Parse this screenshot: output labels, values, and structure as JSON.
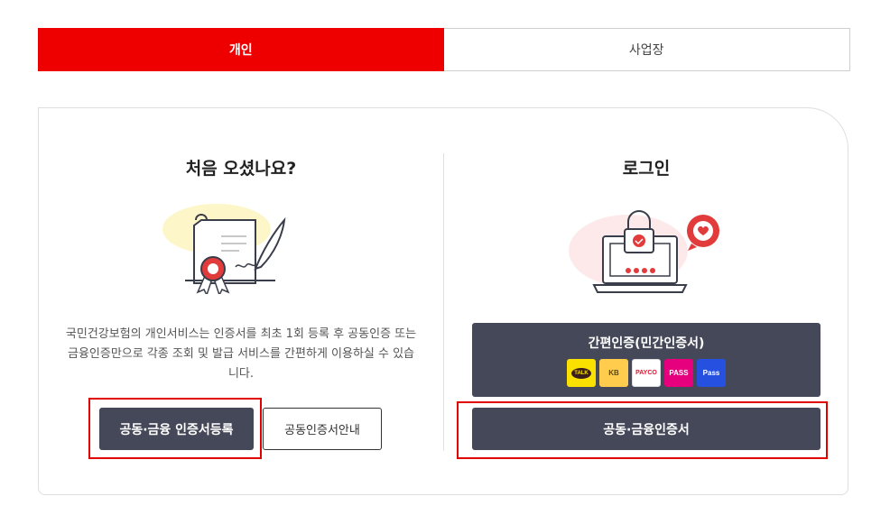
{
  "tabs": [
    {
      "label": "개인",
      "active": true
    },
    {
      "label": "사업장",
      "active": false
    }
  ],
  "left": {
    "title": "처음 오셨나요?",
    "description": "국민건강보험의 개인서비스는 인증서를 최초 1회 등록 후 공동인증 또는 금융인증만으로 각종 조회 및 발급 서비스를 간편하게 이용하실 수 있습니다.",
    "register_button": "공동·금융 인증서등록",
    "guide_button": "공동인증서안내",
    "illustration": "certificate-quill-icon"
  },
  "right": {
    "title": "로그인",
    "simple_auth_label": "간편인증(민간인증서)",
    "simple_auth_providers": [
      "TALK",
      "KB",
      "PAYCO",
      "PASS",
      "Pass"
    ],
    "cert_login_button": "공동·금융인증서",
    "illustration": "laptop-lock-icon"
  },
  "colors": {
    "accent_red": "#ee0000",
    "dark_button": "#454858",
    "highlight_box": "#e00000"
  }
}
